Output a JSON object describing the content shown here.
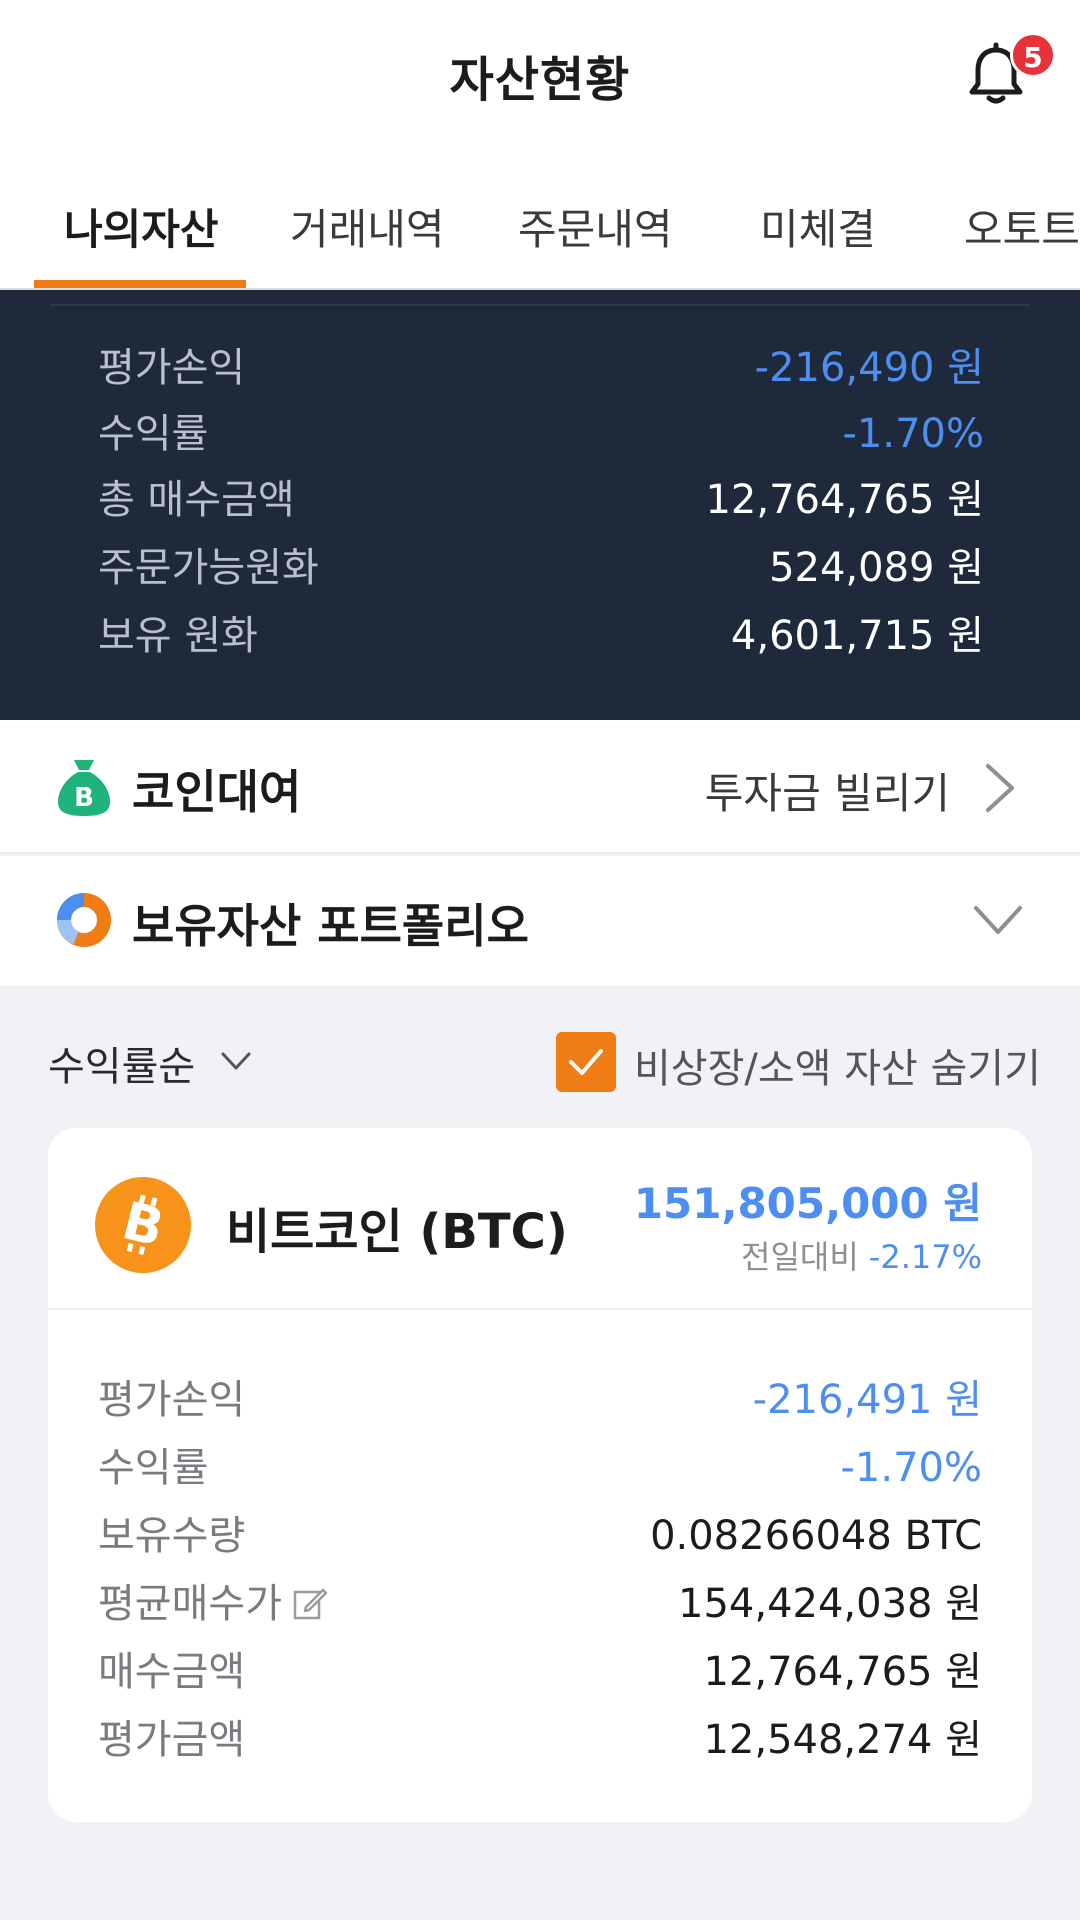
{
  "header": {
    "title": "자산현황",
    "notification_count": "5"
  },
  "tabs": [
    {
      "label": "나의자산",
      "active": true
    },
    {
      "label": "거래내역",
      "active": false
    },
    {
      "label": "주문내역",
      "active": false
    },
    {
      "label": "미체결",
      "active": false
    },
    {
      "label": "오토트",
      "active": false
    }
  ],
  "summary": {
    "rows": [
      {
        "label": "평가손익",
        "value": "-216,490 원"
      },
      {
        "label": "수익률",
        "value": "-1.70%"
      },
      {
        "label": "총 매수금액",
        "value": "12,764,765 원"
      },
      {
        "label": "주문가능원화",
        "value": "524,089 원"
      },
      {
        "label": "보유 원화",
        "value": "4,601,715 원"
      }
    ]
  },
  "lending": {
    "title": "코인대여",
    "link_label": "투자금 빌리기"
  },
  "portfolio": {
    "title": "보유자산 포트폴리오"
  },
  "filters": {
    "sort_label": "수익률순",
    "hide_small_label": "비상장/소액 자산 숨기기",
    "hide_small_checked": true
  },
  "asset_card": {
    "name": "비트코인 (BTC)",
    "price": "151,805,000 원",
    "change_label": "전일대비",
    "change_value": "-2.17%",
    "rows": [
      {
        "label": "평가손익",
        "value": "-216,491 원"
      },
      {
        "label": "수익률",
        "value": "-1.70%"
      },
      {
        "label": "보유수량",
        "value": "0.08266048 BTC"
      },
      {
        "label": "평균매수가",
        "value": "154,424,038 원"
      },
      {
        "label": "매수금액",
        "value": "12,764,765 원"
      },
      {
        "label": "평가금액",
        "value": "12,548,274 원"
      }
    ]
  },
  "colors": {
    "accent_orange": "#f07c16",
    "negative_blue": "#4e8ef0",
    "summary_bg": "#1e2a3b",
    "badge_red": "#e8323a",
    "bitcoin_orange": "#f7931a",
    "lending_green": "#1fb37a"
  }
}
